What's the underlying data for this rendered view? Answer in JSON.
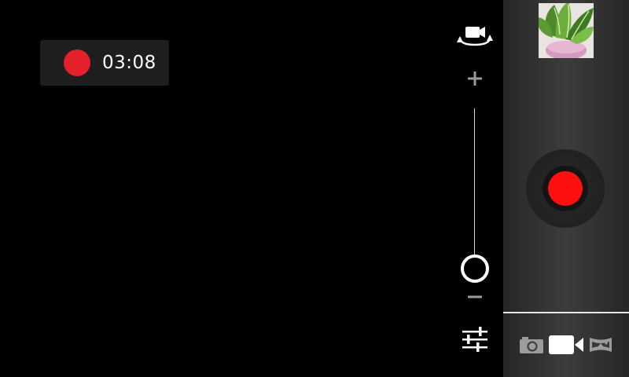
{
  "recording": {
    "elapsed_time": "03:08",
    "indicator_color": "#e4202a",
    "indicator_icon": "record-dot-icon"
  },
  "controls": {
    "switch_camera_icon": "switch-camera-icon",
    "zoom_in_icon": "plus-icon",
    "zoom_out_icon": "minus-icon",
    "zoom_level": 0,
    "settings_icon": "sliders-icon"
  },
  "panel": {
    "thumbnail_icon": "gallery-thumbnail",
    "shutter_icon": "record-button-icon",
    "shutter_color": "#ff1010",
    "modes": [
      {
        "name": "photo",
        "icon": "camera-icon",
        "active": false
      },
      {
        "name": "video",
        "icon": "video-camera-icon",
        "active": true
      },
      {
        "name": "panorama",
        "icon": "panorama-icon",
        "active": false
      }
    ]
  }
}
